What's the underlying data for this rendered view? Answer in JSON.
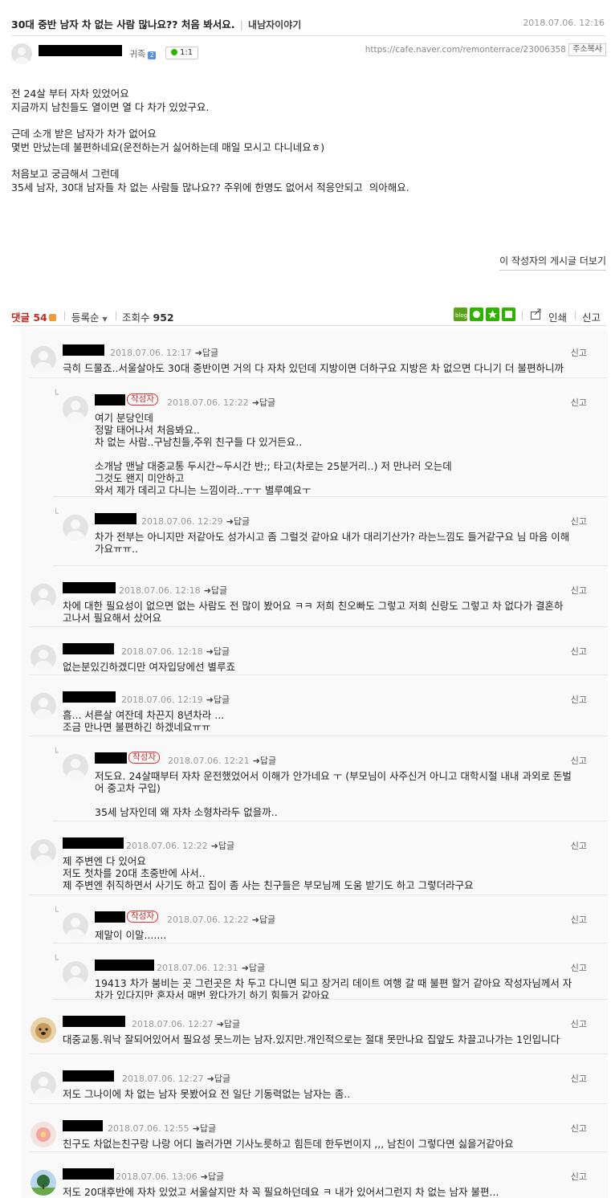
{
  "post": {
    "title": "30대 중반 남자 차 없는 사람 많나요?? 처음 봐서요.",
    "board": "내남자이야기",
    "date": "2018.07.06. 12:16",
    "grade": "귀족",
    "grade_icon": "2",
    "chat": "1:1",
    "url": "https://cafe.naver.com/remonterrace/23006358",
    "copy_label": "주소복사",
    "body": [
      "전 24살 부터 자차 있었어요",
      "지금까지 남친들도 열이면 열 다 차가 있었구요.",
      "",
      "근데 소개 받은 남자가 차가 없어요",
      "몇번 만났는데 불편하네요(운전하는거 싫어하는데 매일 모시고 다니네요ㅎ)",
      "",
      "처음보고 궁금해서 그런데",
      "35세 남자, 30대 남자들 차 없는 사람들 많나요?? 주위에 한명도 없어서 적응안되고  의아해요."
    ],
    "more_label": "이 작성자의 게시글 더보기"
  },
  "bar": {
    "comment_label": "댓글 54",
    "sort_label": "등록순",
    "views_label": "조회수",
    "views": "952",
    "print_label": "인쇄",
    "report_label": "신고"
  },
  "common": {
    "reply_label": "➜답글",
    "report_label": "신고",
    "author_badge": "작성자"
  },
  "comments": [
    {
      "date": "2018.07.06. 12:17",
      "text": "극히 드물죠..서울살아도 30대 중반이면 거의 다 자차 있던데 지방이면 더하구요 지방은 차 없으면 다니기 더 불편하니까"
    },
    {
      "date": "2018.07.06. 12:22",
      "author": true,
      "text": "여기 분당인데\n정말 태어나서 처음봐요..\n차 없는 사람..구남친들,주위 친구들 다 있거든요..\n\n소개남 맨날 대중교통 두시간~두시간 반;; 타고(차로는 25분거리..) 저 만나러 오는데\n그것도 왠지 미안하고\n와서 제가 데리고 다니는 느낌이라..ㅜㅜ 별루예요ㅜ"
    },
    {
      "date": "2018.07.06. 12:29",
      "text": "차가 전부는 아니지만 저같아도 성가시고 좀 그럴것 같아요 내가 대리기산가? 라는느낌도 들거같구요 님 마음 이해\n가요ㅠㅠ.."
    },
    {
      "date": "2018.07.06. 12:18",
      "text": "차에 대한 필요성이 없으면 없는 사람도 전 많이 봤어요 ㅋㅋ 저희 친오빠도 그렇고 저희 신랑도 그렇고 차 없다가 결혼하\n고나서 필요해서 샀어요"
    },
    {
      "date": "2018.07.06. 12:18",
      "text": "없는분있긴하겠디만 여자입당에선 별루죠"
    },
    {
      "date": "2018.07.06. 12:19",
      "text": "흠... 서른살 여잔데 차끈지 8년차라 ...\n조금 만나면 불편하긴 하겠네요ㅠㅠ"
    },
    {
      "date": "2018.07.06. 12:21",
      "author": true,
      "text": "저도요. 24살때부터 자차 운전했었어서 이해가 안가네요 ㅜ (부모님이 사주신거 아니고 대학시절 내내 과외로 돈벌\n어 중고차 구입)\n\n35세 남자인데 왜 자차 소형차라두 없을까.."
    },
    {
      "date": "2018.07.06. 12:22",
      "text": "제 주변엔 다 있어요\n저도 첫차를 20대 초중반에 사서..\n제 주변엔 취직하면서 사기도 하고 집이 좀 사는 친구들은 부모님께 도움 받기도 하고 그렇더라구요"
    },
    {
      "date": "2018.07.06. 12:22",
      "author": true,
      "text": "제말이 이말......."
    },
    {
      "date": "2018.07.06. 12:31",
      "text": "19413 차가 붐비는 곳 그런곳은 차 두고 다니면 되고 장거리 데이트 여행 갈 때 불편 할거 같아요 작성자님께서 자\n차가 있다지만 혼자서 매번 왔다가기 하기 힘들거 같아요"
    },
    {
      "date": "2018.07.06. 12:27",
      "text": "대중교통.워낙 잘되어있어서 필요성 못느끼는 남자.있지만.개인적으로는 절대 못만나요 집앞도 차끌고나가는 1인입니다"
    },
    {
      "date": "2018.07.06. 12:27",
      "text": "저도 그나이에 차 없는 남자 못봤어요 전 일단 기동력없는 남자는 좀.."
    },
    {
      "date": "2018.07.06. 12:55",
      "text": "친구도 차없는친구랑 나랑 어디 놀러가면 기사노릇하고 힘든데 한두번이지 ,,, 남친이 그렇다면 싫을거같아요"
    },
    {
      "date": "2018.07.06. 13:06",
      "text": "저도 20대후반에 자차 있었고 서울살지만 차 꼭 필요하던데요 ㅋ 내가 있어서그런지 차 없는 남자 불편..."
    }
  ],
  "colors": {
    "accent": "#c5271f",
    "blog": "#5aa31b",
    "share": "#2db400"
  },
  "icons": [
    "share-icon",
    "blog-icon",
    "star-icon",
    "check-icon"
  ]
}
